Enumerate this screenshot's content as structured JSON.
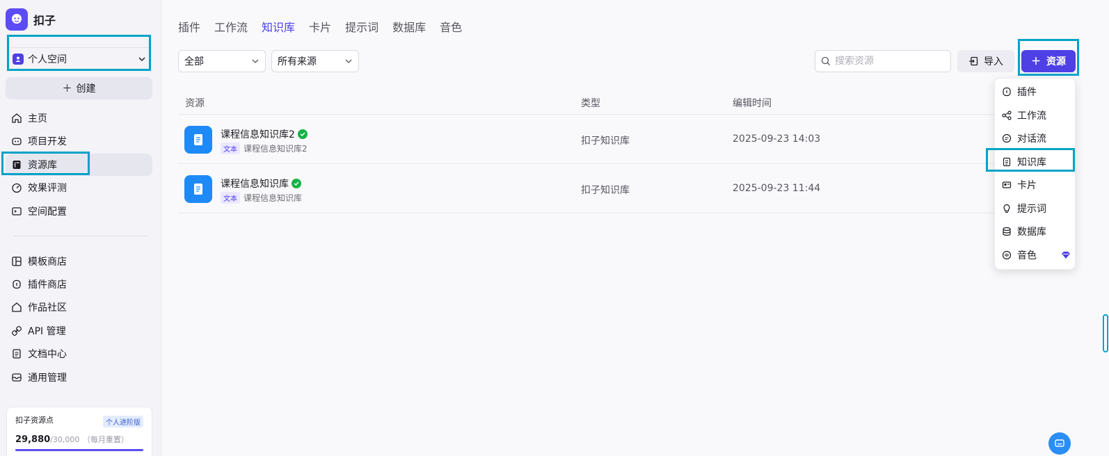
{
  "brand": {
    "name": "扣子"
  },
  "space": {
    "label": "个人空间"
  },
  "sidebar": {
    "create_label": "创建",
    "nav_main": [
      {
        "label": "主页",
        "icon": "home-icon"
      },
      {
        "label": "项目开发",
        "icon": "project-icon"
      },
      {
        "label": "资源库",
        "icon": "library-icon",
        "active": true
      },
      {
        "label": "效果评测",
        "icon": "gauge-icon"
      },
      {
        "label": "空间配置",
        "icon": "terminal-icon"
      }
    ],
    "nav_secondary": [
      {
        "label": "模板商店",
        "icon": "template-icon"
      },
      {
        "label": "插件商店",
        "icon": "plugin-icon"
      },
      {
        "label": "作品社区",
        "icon": "community-icon"
      },
      {
        "label": "API 管理",
        "icon": "api-icon"
      },
      {
        "label": "文档中心",
        "icon": "doc-icon"
      },
      {
        "label": "通用管理",
        "icon": "settings-box-icon"
      }
    ],
    "points": {
      "title": "扣子资源点",
      "badge": "个人进阶版",
      "value": "29,880",
      "total": "/30,000",
      "note": "（每月重置）"
    }
  },
  "tabs": [
    {
      "label": "插件"
    },
    {
      "label": "工作流"
    },
    {
      "label": "知识库",
      "active": true
    },
    {
      "label": "卡片"
    },
    {
      "label": "提示词"
    },
    {
      "label": "数据库"
    },
    {
      "label": "音色"
    }
  ],
  "filters": {
    "type": "全部",
    "source": "所有来源"
  },
  "search": {
    "placeholder": "搜索资源"
  },
  "toolbar": {
    "import_label": "导入",
    "add_label": "资源"
  },
  "table": {
    "headers": [
      "资源",
      "类型",
      "编辑时间"
    ],
    "rows": [
      {
        "name": "课程信息知识库2",
        "tag": "文本",
        "desc": "课程信息知识库2",
        "type": "扣子知识库",
        "time": "2025-09-23 14:03"
      },
      {
        "name": "课程信息知识库",
        "tag": "文本",
        "desc": "课程信息知识库",
        "type": "扣子知识库",
        "time": "2025-09-23 11:44"
      }
    ]
  },
  "dropdown": {
    "items": [
      {
        "label": "插件",
        "icon": "plugin-icon"
      },
      {
        "label": "工作流",
        "icon": "workflow-icon"
      },
      {
        "label": "对话流",
        "icon": "chatflow-icon"
      },
      {
        "label": "知识库",
        "icon": "knowledge-icon"
      },
      {
        "label": "卡片",
        "icon": "card-icon"
      },
      {
        "label": "提示词",
        "icon": "bulb-icon"
      },
      {
        "label": "数据库",
        "icon": "database-icon"
      },
      {
        "label": "音色",
        "icon": "voice-icon"
      }
    ]
  },
  "colors": {
    "accent": "#4e40e5",
    "highlight": "#00a3c8",
    "check": "#14b346",
    "file_icon": "#1e8af7"
  }
}
